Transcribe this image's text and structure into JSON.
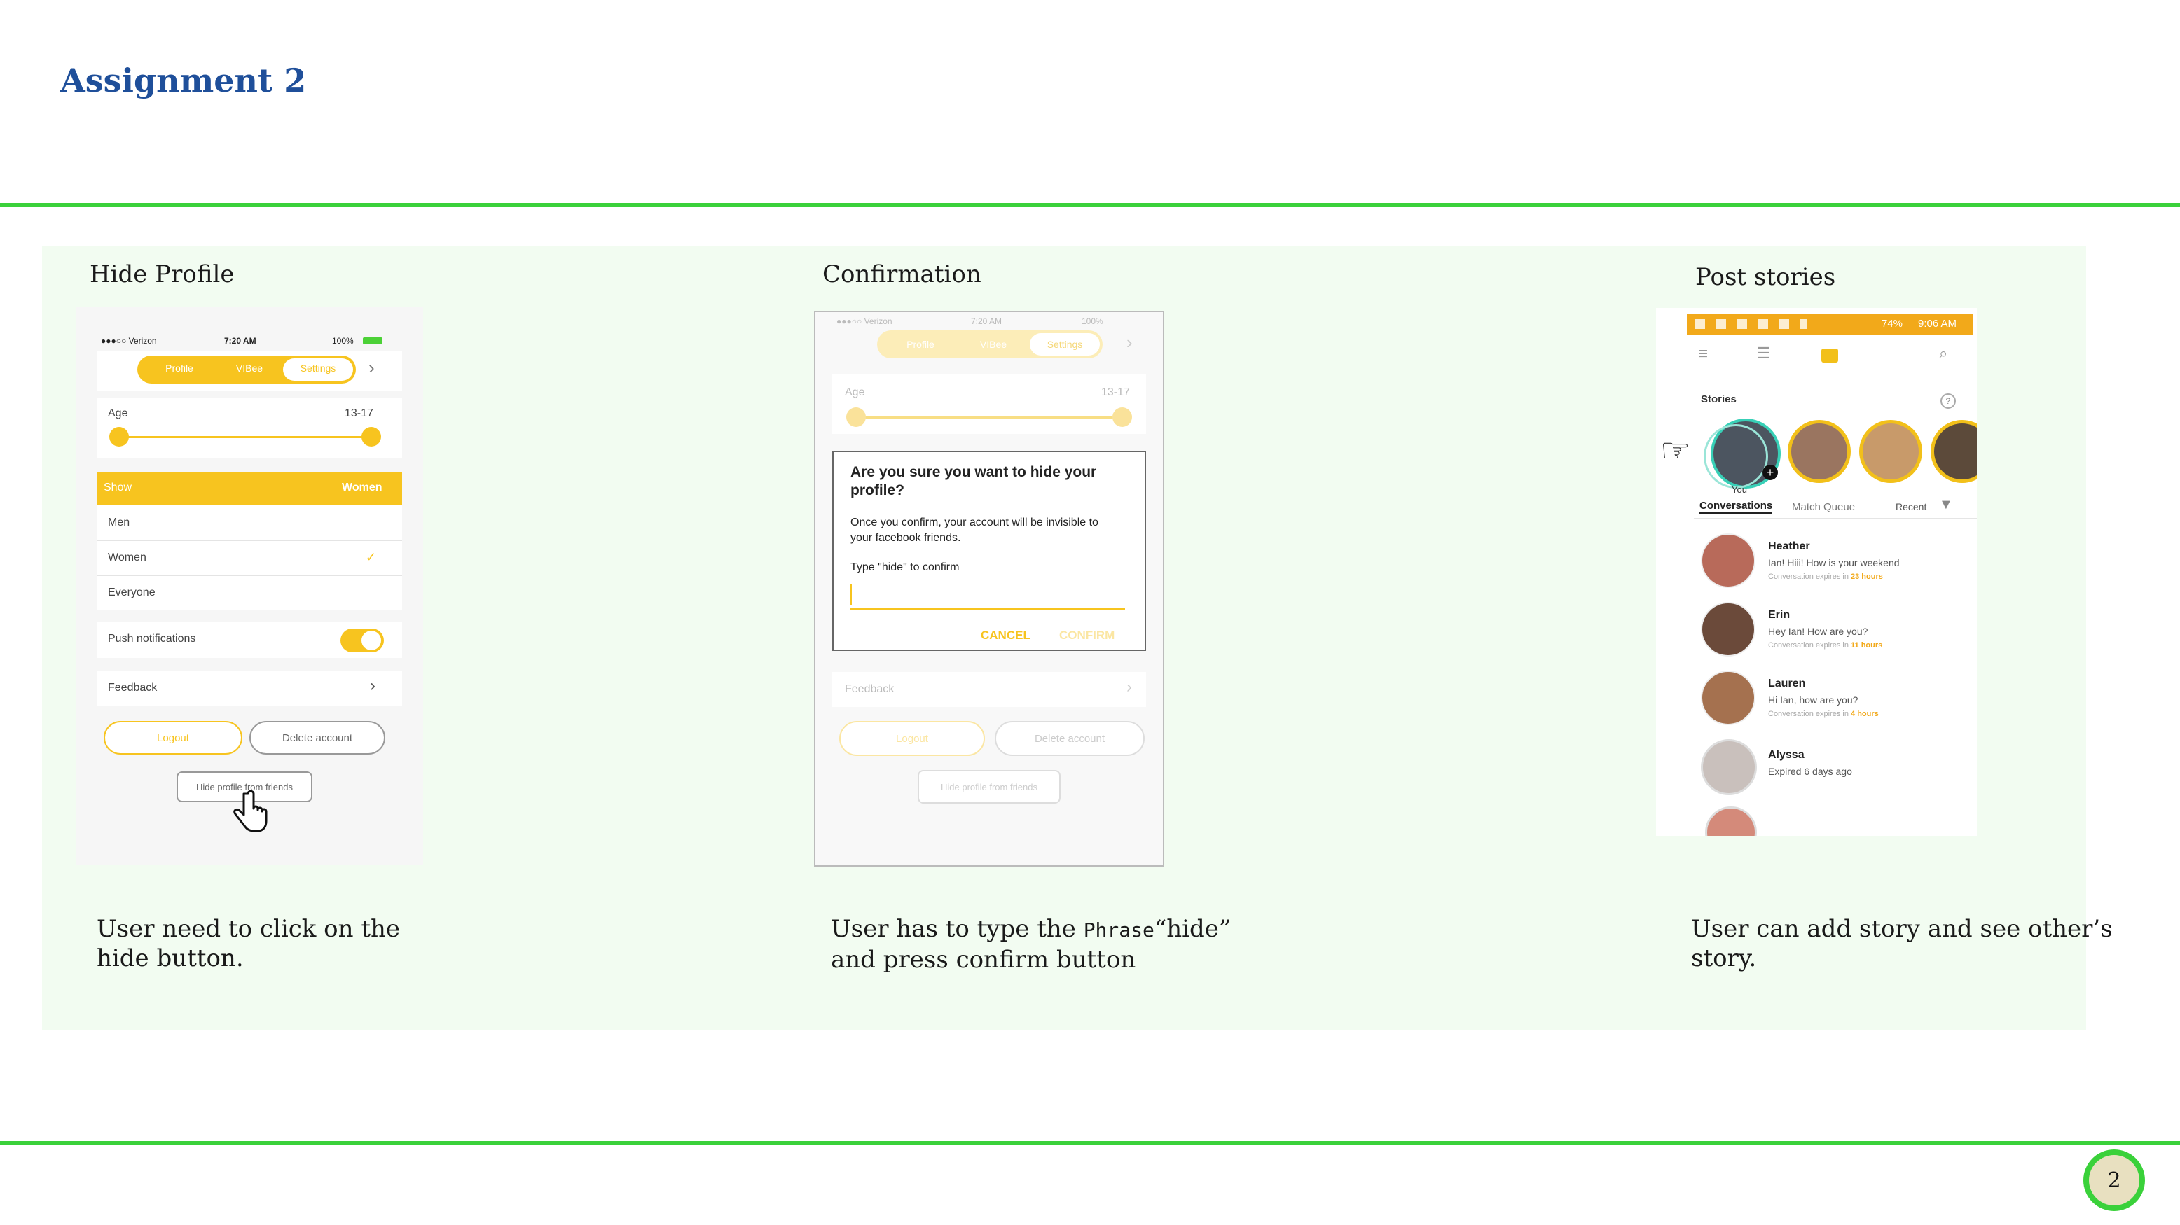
{
  "slide": {
    "title": "Assignment 2",
    "page_number": "2"
  },
  "colors": {
    "title": "#1f4f9a",
    "rule": "#3ad13a",
    "panel": "#f2fcf1",
    "accent_yellow": "#f7c41f"
  },
  "columns": [
    {
      "title": "Hide Profile",
      "caption_line1": "User need to click on the",
      "caption_line2": "hide button."
    },
    {
      "title": "Confirmation",
      "caption_pre": "User has to type the ",
      "caption_phrase": "Phrase",
      "caption_post": "“hide”",
      "caption_line2": "and press confirm button"
    },
    {
      "title": "Post stories",
      "caption_line1": "User can add story and see other’s",
      "caption_line2": "story."
    }
  ],
  "phone1": {
    "status_carrier": "●●●○○ Verizon",
    "status_time": "7:20 AM",
    "status_battery": "100%",
    "tabs": [
      "Profile",
      "VIBee",
      "Settings"
    ],
    "age_label": "Age",
    "age_range": "13-17",
    "show_label": "Show",
    "show_value": "Women",
    "options": [
      "Men",
      "Women",
      "Everyone"
    ],
    "selected_option": "Women",
    "push_label": "Push notifications",
    "push_on": true,
    "feedback_label": "Feedback",
    "logout": "Logout",
    "delete": "Delete account",
    "hide": "Hide profile from friends"
  },
  "phone2": {
    "status_carrier": "●●●○○ Verizon",
    "status_time": "7:20 AM",
    "status_battery": "100%",
    "tabs": [
      "Profile",
      "VIBee",
      "Settings"
    ],
    "age_label": "Age",
    "age_range": "13-17",
    "dialog_title": "Are you sure you want to hide your profile?",
    "dialog_body": "Once you confirm, your account will be invisible to your facebook friends.",
    "dialog_prompt": "Type \"hide\" to confirm",
    "cancel": "CANCEL",
    "confirm": "CONFIRM",
    "feedback_label": "Feedback",
    "logout": "Logout",
    "delete": "Delete account",
    "hide": "Hide profile from friends"
  },
  "phone3": {
    "status_battery": "74%",
    "status_time": "9:06 AM",
    "stories_label": "Stories",
    "you_label": "You",
    "tabs": [
      "Conversations",
      "Match Queue"
    ],
    "sort_label": "Recent",
    "conversations": [
      {
        "name": "Heather",
        "message": "Ian! Hiii! How is your weekend",
        "expiry_pre": "Conversation expires in ",
        "expiry_time": "23 hours",
        "color": "#b86a5a"
      },
      {
        "name": "Erin",
        "message": "Hey Ian! How are you?",
        "expiry_pre": "Conversation expires in ",
        "expiry_time": "11 hours",
        "color": "#6b4a3a"
      },
      {
        "name": "Lauren",
        "message": "Hi Ian, how are you?",
        "expiry_pre": "Conversation expires in ",
        "expiry_time": "4 hours",
        "color": "#a5714f"
      },
      {
        "name": "Alyssa",
        "message": "Expired 6 days ago",
        "expiry_pre": "",
        "expiry_time": "",
        "color": "#c9c0bc"
      }
    ]
  }
}
